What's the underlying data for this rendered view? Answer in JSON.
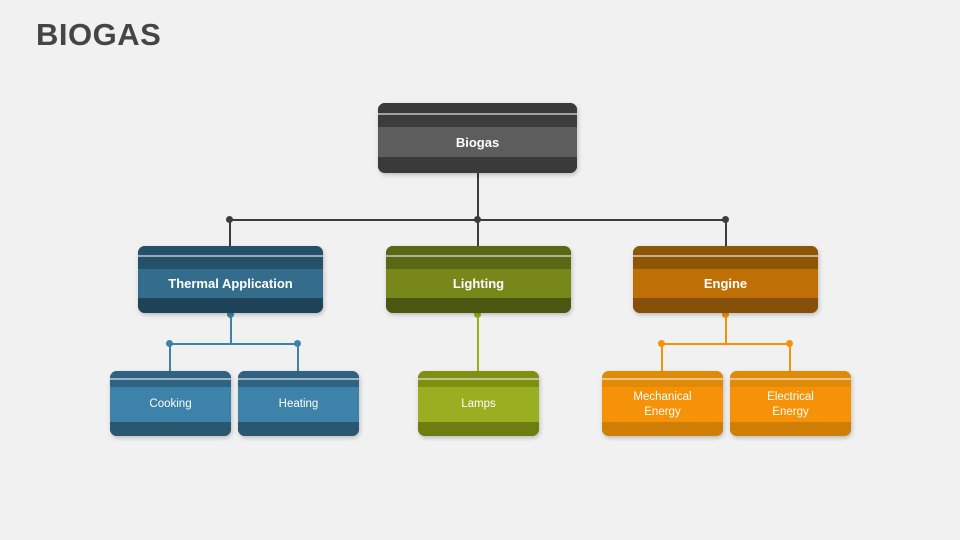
{
  "page": {
    "title": "BIOGAS",
    "background_color": "#f1f1f1",
    "title_color": "#454545"
  },
  "chart_data": {
    "type": "diagram",
    "diagram_type": "organizational-tree",
    "title": "BIOGAS",
    "levels": 3,
    "nodes": [
      {
        "id": "root",
        "label": "Biogas",
        "level": 1,
        "parent": null
      },
      {
        "id": "thermal",
        "label": "Thermal Application",
        "level": 2,
        "parent": "root"
      },
      {
        "id": "lighting",
        "label": "Lighting",
        "level": 2,
        "parent": "root"
      },
      {
        "id": "engine",
        "label": "Engine",
        "level": 2,
        "parent": "root"
      },
      {
        "id": "cooking",
        "label": "Cooking",
        "level": 3,
        "parent": "thermal"
      },
      {
        "id": "heating",
        "label": "Heating",
        "level": 3,
        "parent": "thermal"
      },
      {
        "id": "lamps",
        "label": "Lamps",
        "level": 3,
        "parent": "lighting"
      },
      {
        "id": "mechanical",
        "label": "Mechanical\nEnergy",
        "level": 3,
        "parent": "engine"
      },
      {
        "id": "electrical",
        "label": "Electrical\nEnergy",
        "level": 3,
        "parent": "engine"
      }
    ],
    "edges": [
      {
        "from": "root",
        "to": "thermal"
      },
      {
        "from": "root",
        "to": "lighting"
      },
      {
        "from": "root",
        "to": "engine"
      },
      {
        "from": "thermal",
        "to": "cooking"
      },
      {
        "from": "thermal",
        "to": "heating"
      },
      {
        "from": "lighting",
        "to": "lamps"
      },
      {
        "from": "engine",
        "to": "mechanical"
      },
      {
        "from": "engine",
        "to": "electrical"
      }
    ]
  },
  "nodes": {
    "root": {
      "label": "Biogas",
      "cap_color": "#2f2f2f",
      "band_color": "#5d5d5d",
      "foot_color": "#3a3a3a",
      "connector_color": "#3c3c3c"
    },
    "thermal": {
      "label": "Thermal Application",
      "cap_color": "#1e4258",
      "band_color": "#346c8c",
      "foot_color": "#1e4258",
      "connector_color": "#3d82a8"
    },
    "lighting": {
      "label": "Lighting",
      "cap_color": "#4b5611",
      "band_color": "#77871a",
      "foot_color": "#4b5611",
      "connector_color": "#9aae21"
    },
    "engine": {
      "label": "Engine",
      "cap_color": "#86500a",
      "band_color": "#be7007",
      "foot_color": "#86500a",
      "connector_color": "#f59207"
    },
    "cooking": {
      "label": "Cooking",
      "cap_color": "#2e6384",
      "band_color": "#3d82a8",
      "foot_color": "#2a566f"
    },
    "heating": {
      "label": "Heating",
      "cap_color": "#2e6384",
      "band_color": "#3d82a8",
      "foot_color": "#2a566f"
    },
    "lamps": {
      "label": "Lamps",
      "cap_color": "#7f9010",
      "band_color": "#9aae21",
      "foot_color": "#6d7d0f"
    },
    "mechanical": {
      "label": "Mechanical\nEnergy",
      "cap_color": "#e08a07",
      "band_color": "#f59207",
      "foot_color": "#d07f06"
    },
    "electrical": {
      "label": "Electrical\nEnergy",
      "cap_color": "#e08a07",
      "band_color": "#f59207",
      "foot_color": "#d07f06"
    }
  }
}
